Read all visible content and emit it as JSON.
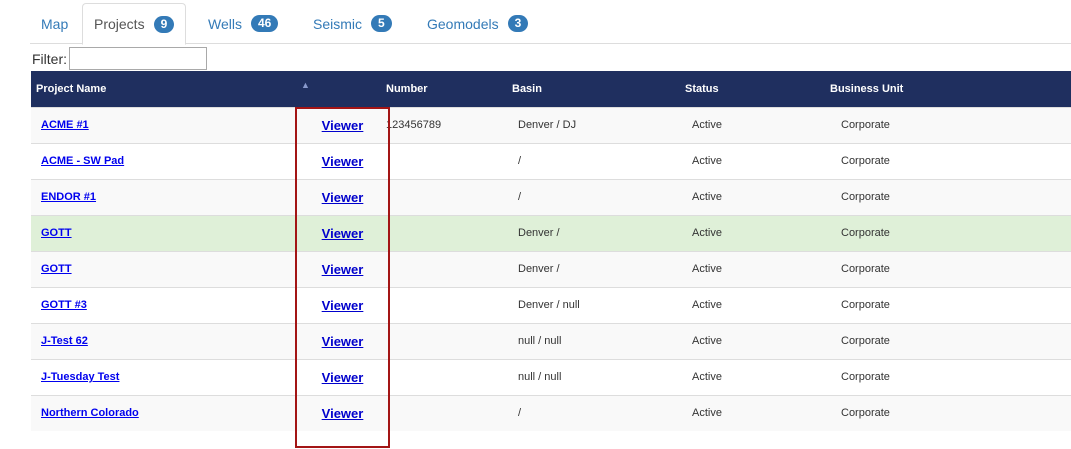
{
  "tabs": [
    {
      "label": "Map",
      "badge": null
    },
    {
      "label": "Projects",
      "badge": "9"
    },
    {
      "label": "Wells",
      "badge": "46"
    },
    {
      "label": "Seismic",
      "badge": "5"
    },
    {
      "label": "Geomodels",
      "badge": "3"
    }
  ],
  "filter": {
    "label": "Filter:",
    "value": ""
  },
  "table": {
    "headers": {
      "name": "Project Name",
      "sort_icon": "▲",
      "number": "Number",
      "basin": "Basin",
      "status": "Status",
      "business_unit": "Business Unit"
    },
    "rows": [
      {
        "name": "ACME #1",
        "viewer": "Viewer",
        "number": "123456789",
        "basin": "Denver / DJ",
        "status": "Active",
        "unit": "Corporate"
      },
      {
        "name": "ACME - SW Pad",
        "viewer": "Viewer",
        "number": "",
        "basin": "/",
        "status": "Active",
        "unit": "Corporate"
      },
      {
        "name": "ENDOR #1",
        "viewer": "Viewer",
        "number": "",
        "basin": "/",
        "status": "Active",
        "unit": "Corporate"
      },
      {
        "name": "GOTT",
        "viewer": "Viewer",
        "number": "",
        "basin": "Denver /",
        "status": "Active",
        "unit": "Corporate"
      },
      {
        "name": "GOTT",
        "viewer": "Viewer",
        "number": "",
        "basin": "Denver /",
        "status": "Active",
        "unit": "Corporate"
      },
      {
        "name": "GOTT #3",
        "viewer": "Viewer",
        "number": "",
        "basin": "Denver / null",
        "status": "Active",
        "unit": "Corporate"
      },
      {
        "name": "J-Test 62",
        "viewer": "Viewer",
        "number": "",
        "basin": "null / null",
        "status": "Active",
        "unit": "Corporate"
      },
      {
        "name": "J-Tuesday Test",
        "viewer": "Viewer",
        "number": "",
        "basin": "null / null",
        "status": "Active",
        "unit": "Corporate"
      },
      {
        "name": "Northern Colorado",
        "viewer": "Viewer",
        "number": "",
        "basin": "/",
        "status": "Active",
        "unit": "Corporate"
      }
    ]
  },
  "colors": {
    "header_bg": "#1f2f5f",
    "link": "#0000ee",
    "tab_link": "#337ab7",
    "badge": "#337ab7",
    "hover_row": "#dff0d8",
    "highlight_box": "#a31515"
  }
}
